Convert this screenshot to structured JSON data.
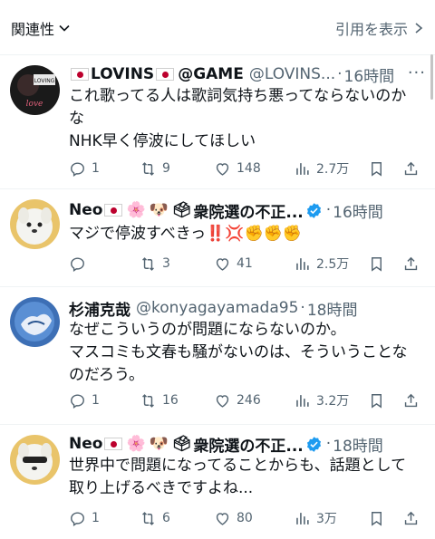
{
  "header": {
    "sort_label": "関連性",
    "quote_label": "引用を表示"
  },
  "tweets": [
    {
      "name": "LOVINS",
      "name_suffix": "@GAME",
      "handle": "@LOVINS...",
      "dot": "·",
      "time": "16時間",
      "lines": [
        "これ歌ってる人は歌詞気持ち悪ってならないのか",
        "な",
        "NHK早く停波にしてほしい"
      ],
      "reply_count": "1",
      "retweet_count": "9",
      "like_count": "148",
      "view_count": "2.7万",
      "avatar_text_1": "LOVING",
      "avatar_text_2": "love"
    },
    {
      "name": "Neo",
      "name_suffix": "衆院選の不正...",
      "handle": "",
      "dot": "·",
      "time": "16時間",
      "lines": [
        "マジで停波すべきっ‼️💢✊✊✊"
      ],
      "reply_count": "",
      "retweet_count": "3",
      "like_count": "41",
      "view_count": "2.5万"
    },
    {
      "name": "杉浦克哉",
      "name_suffix": "",
      "handle": "@konyagayamada95",
      "dot": "·",
      "time": "18時間",
      "lines": [
        "なぜこういうのが問題にならないのか。",
        "マスコミも文春も騒がないのは、そういうことな",
        "のだろう。"
      ],
      "reply_count": "1",
      "retweet_count": "16",
      "like_count": "246",
      "view_count": "3.2万"
    },
    {
      "name": "Neo",
      "name_suffix": "衆院選の不正...",
      "handle": "",
      "dot": "·",
      "time": "18時間",
      "lines": [
        "世界中で問題になってることからも、話題として",
        "取り上げるべきですよね..."
      ],
      "reply_count": "1",
      "retweet_count": "6",
      "like_count": "80",
      "view_count": "3万"
    }
  ],
  "colors": {
    "text": "#0f1419",
    "secondary": "#536471",
    "divider": "#eff3f4",
    "verified": "#1d9bf0",
    "flag_red": "#bc002d"
  },
  "icons": [
    "chevron-down-icon",
    "chevron-right-icon",
    "more-icon",
    "reply-icon",
    "retweet-icon",
    "like-icon",
    "views-icon",
    "bookmark-icon",
    "share-icon",
    "verified-icon"
  ]
}
